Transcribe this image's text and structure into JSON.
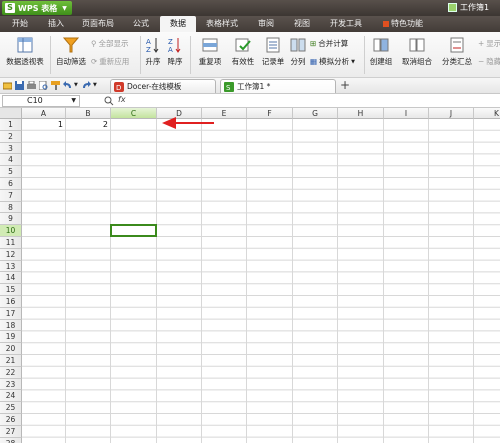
{
  "app": {
    "name": "WPS 表格",
    "logo_letter": "S",
    "workbook_title": "工作簿1"
  },
  "menu": {
    "tabs": [
      "开始",
      "插入",
      "页面布局",
      "公式",
      "数据",
      "表格样式",
      "审阅",
      "视图",
      "开发工具",
      "特色功能"
    ],
    "active": "数据"
  },
  "ribbon": {
    "pivot": "数据透视表",
    "autofilter": "自动筛选",
    "show_all": "全部显示",
    "reapply": "重新应用",
    "sort_asc": "升序",
    "sort_desc": "降序",
    "duplicates": "重复项",
    "validity": "有效性",
    "record": "记录单",
    "split": "分列",
    "consolidate": "合并计算",
    "whatif": "模拟分析",
    "group": "创建组",
    "ungroup": "取消组合",
    "subtotal": "分类汇总",
    "show_detail": "显示明细数据",
    "hide_detail": "隐藏明细数据"
  },
  "doc_tabs": [
    {
      "label": "Docer-在线模板"
    },
    {
      "label": "工作簿1 *"
    }
  ],
  "formula_bar": {
    "cell_ref": "C10",
    "fx": "fx",
    "value": ""
  },
  "sheet": {
    "columns": [
      "A",
      "B",
      "C",
      "D",
      "E",
      "F",
      "G",
      "H",
      "I",
      "J",
      "K"
    ],
    "selected_column": "C",
    "rows": [
      "1",
      "2",
      "3",
      "4",
      "5",
      "6",
      "7",
      "8",
      "9",
      "10",
      "11",
      "12",
      "13",
      "14",
      "15",
      "16",
      "17",
      "18",
      "19",
      "20",
      "21",
      "22",
      "23",
      "24",
      "25",
      "26",
      "27",
      "28"
    ],
    "selected_row": "10",
    "cells": {
      "A1": "1",
      "B1": "2"
    },
    "selected_cell": "C10"
  },
  "colors": {
    "accent_green": "#3b8a1c",
    "annotation_arrow": "#e02020"
  }
}
